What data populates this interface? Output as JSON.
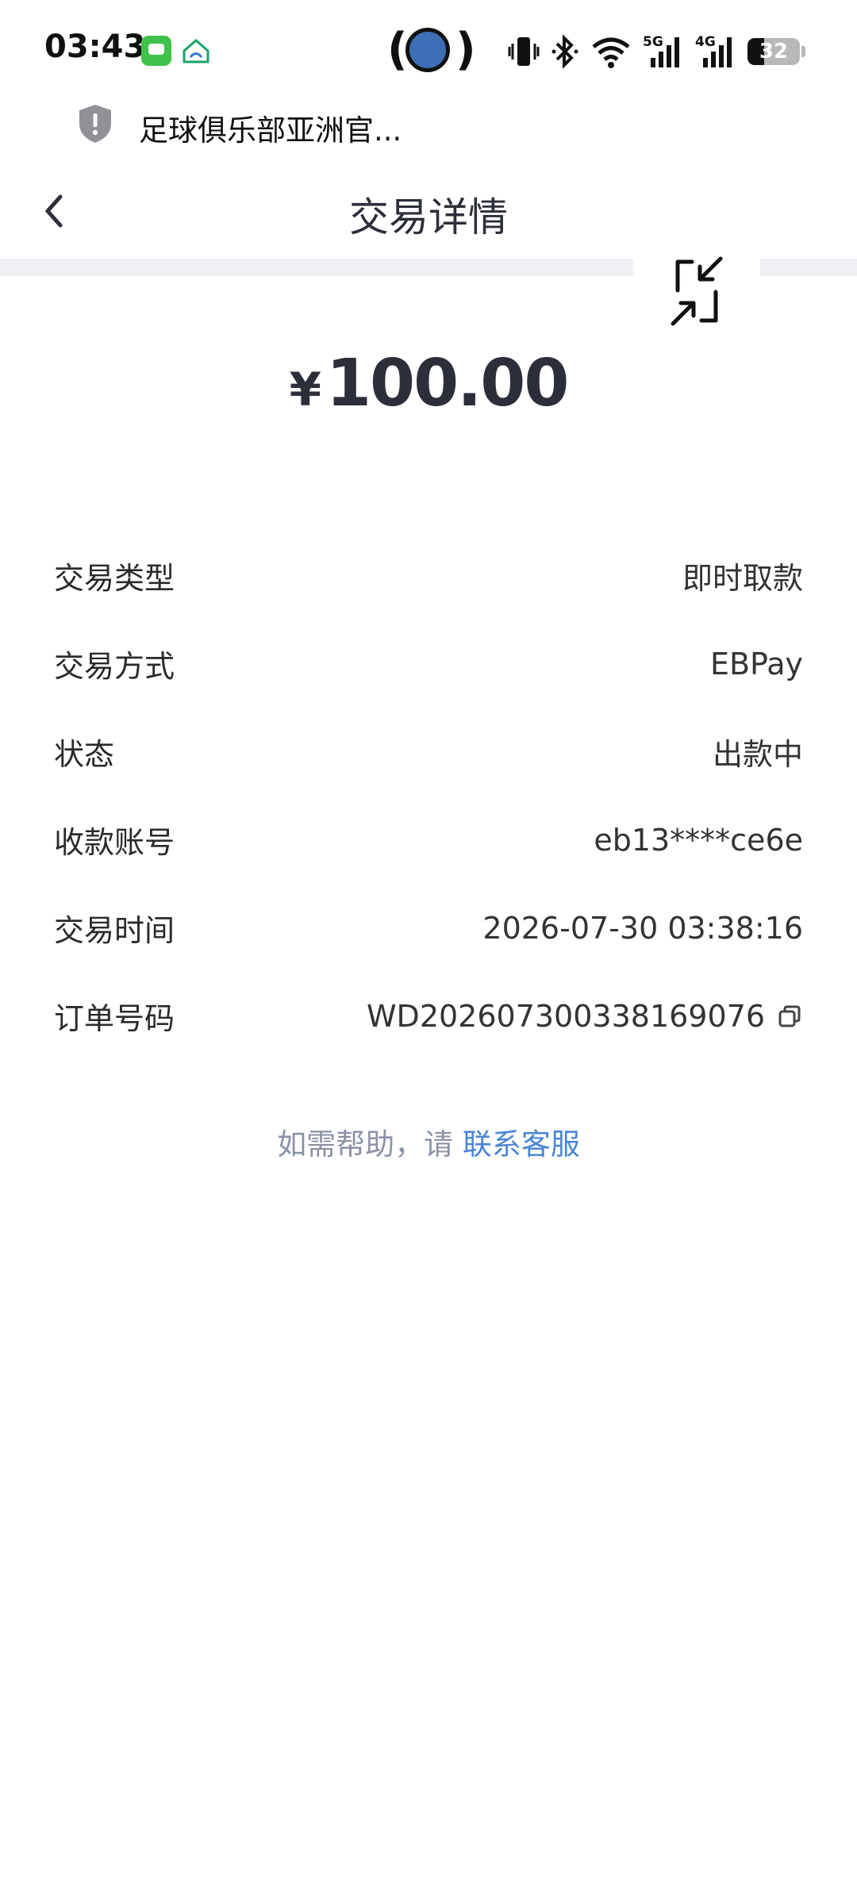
{
  "status_bar": {
    "time": "03:43",
    "battery_level": "32",
    "network_5g": "5G",
    "network_4g": "4G"
  },
  "site_banner": {
    "name": "足球俱乐部亚洲官..."
  },
  "header": {
    "title": "交易详情"
  },
  "amount": {
    "currency_symbol": "¥",
    "value": "100.00"
  },
  "details": [
    {
      "label": "交易类型",
      "value": "即时取款"
    },
    {
      "label": "交易方式",
      "value": "EBPay"
    },
    {
      "label": "状态",
      "value": "出款中"
    },
    {
      "label": "收款账号",
      "value": "eb13****ce6e"
    },
    {
      "label": "交易时间",
      "value": "2026-07-30 03:38:16"
    },
    {
      "label": "订单号码",
      "value": "WD202607300338169076"
    }
  ],
  "help": {
    "prefix": "如需帮助，请 ",
    "link": "联系客服"
  },
  "colors": {
    "link": "#4a84d4",
    "title_text": "#2c2f3a",
    "band": "#eef0f4"
  }
}
